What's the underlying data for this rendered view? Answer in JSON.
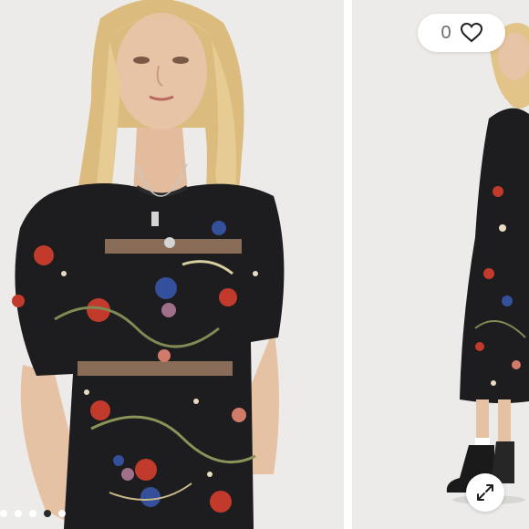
{
  "listing": {
    "like_count": "0",
    "like_icon": "heart-outline-icon",
    "expand_icon": "expand-arrows-icon"
  },
  "carousel": {
    "dot_count": 5,
    "active_index": 3
  },
  "colors": {
    "background": "#ffffff",
    "studio_backdrop": "#ecebe9",
    "dress": "#1d1c1e",
    "floral_red": "#c23a2c",
    "floral_blue": "#35509a",
    "hair": "#e2c488",
    "skin": "#e8c4a6",
    "text_muted": "#6b6b6b",
    "active_dot": "#2a2a2a"
  }
}
